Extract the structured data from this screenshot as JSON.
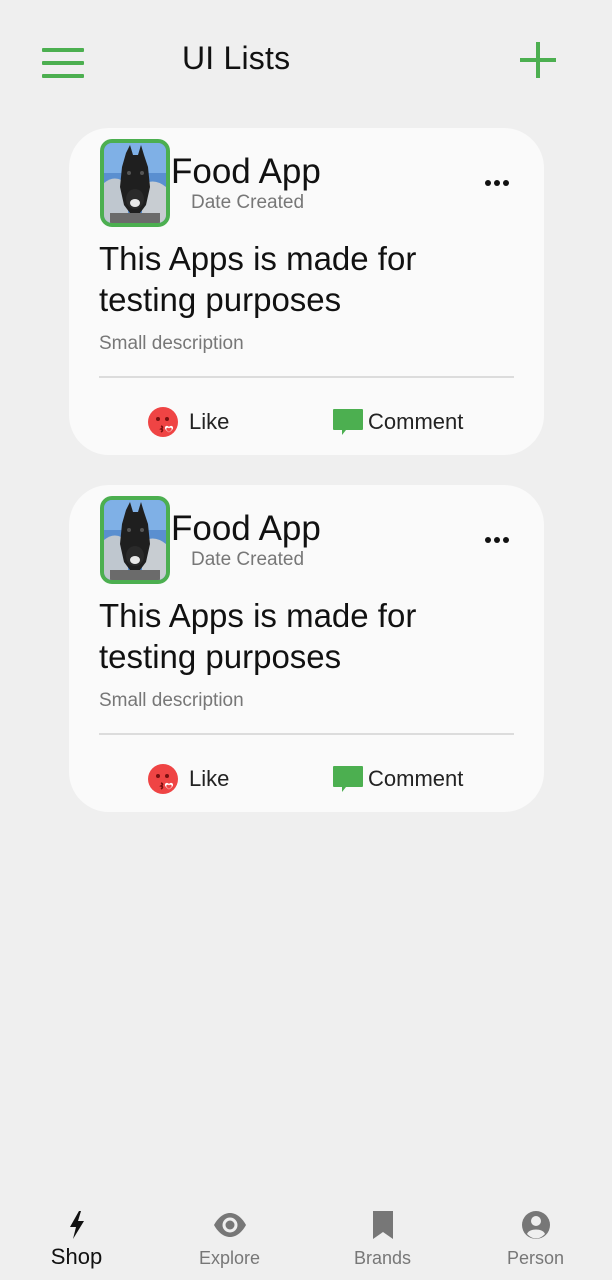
{
  "header": {
    "title": "UI Lists"
  },
  "cards": [
    {
      "title": "Food App",
      "date": "Date Created",
      "headline": "This Apps is made for testing purposes",
      "description": "Small description",
      "like_label": "Like",
      "comment_label": "Comment"
    },
    {
      "title": "Food App",
      "date": "Date Created",
      "headline": "This Apps is made for testing purposes",
      "description": "Small description",
      "like_label": "Like",
      "comment_label": "Comment"
    }
  ],
  "bottom_nav": {
    "items": [
      {
        "label": "Shop",
        "icon": "bolt-icon",
        "active": true
      },
      {
        "label": "Explore",
        "icon": "eye-icon",
        "active": false
      },
      {
        "label": "Brands",
        "icon": "bookmark-icon",
        "active": false
      },
      {
        "label": "Person",
        "icon": "person-icon",
        "active": false
      }
    ]
  },
  "colors": {
    "accent": "#4caf50",
    "background": "#efefef",
    "card": "#fafafa",
    "like": "#ef4444",
    "muted_text": "#777777"
  }
}
